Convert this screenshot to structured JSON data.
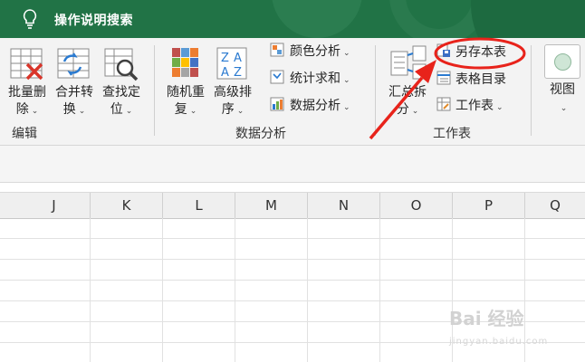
{
  "titlebar": {
    "search_label": "操作说明搜索",
    "color": "#217346"
  },
  "ribbon": {
    "edit_group": {
      "label": "编辑",
      "batch_delete": {
        "line1": "批量删",
        "line2": "除"
      },
      "merge_convert": {
        "line1": "合并转",
        "line2": "换"
      },
      "find_locate": {
        "line1": "查找定",
        "line2": "位"
      }
    },
    "data_group": {
      "label": "数据分析",
      "random_dup": {
        "line1": "随机重",
        "line2": "复"
      },
      "advanced_sort": {
        "line1": "高级排",
        "line2": "序"
      },
      "color_analysis": "颜色分析",
      "stats_sum": "统计求和",
      "data_analysis": "数据分析"
    },
    "sheet_group": {
      "label": "工作表",
      "summarize_split": {
        "line1": "汇总拆",
        "line2": "分"
      },
      "save_sheet": "另存本表",
      "sheet_index": "表格目录",
      "worksheet": "工作表"
    },
    "view": {
      "label": "视图"
    }
  },
  "columns": [
    "J",
    "K",
    "L",
    "M",
    "N",
    "O",
    "P",
    "Q"
  ],
  "annotation": {
    "color": "#e8231b"
  },
  "watermark": {
    "text": "Bai 经验",
    "sub": "jingyan.baidu.com"
  }
}
